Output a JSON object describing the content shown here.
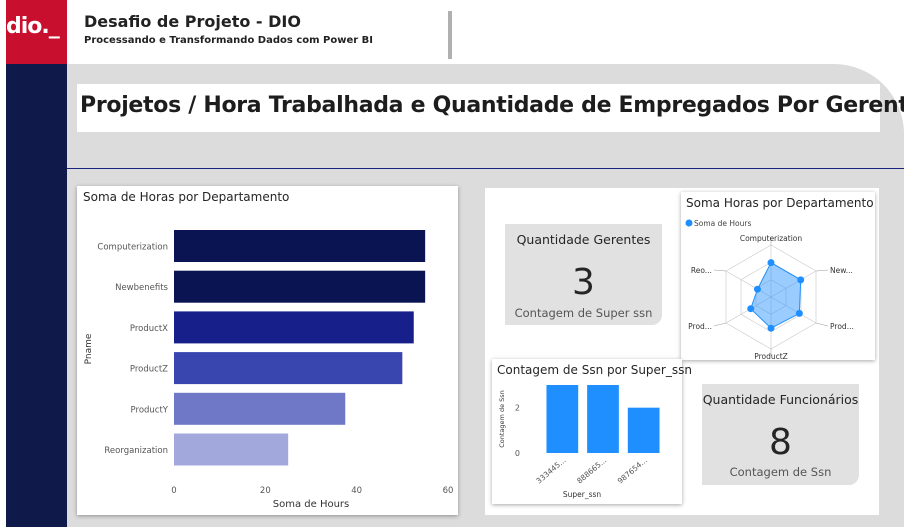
{
  "header": {
    "logo_text": "dio._",
    "title": "Desafio de Projeto - DIO",
    "subtitle": "Processando e Transformando Dados com Power BI"
  },
  "page_title": "Projetos / Hora Trabalhada e Quantidade de Empregados Por Gerentes",
  "kpis": {
    "gerentes": {
      "title": "Quantidade Gerentes",
      "value": "3",
      "subtitle": "Contagem de Super ssn"
    },
    "funcionarios": {
      "title": "Quantidade Funcionários",
      "value": "8",
      "subtitle": "Contagem de Ssn"
    }
  },
  "colors": {
    "sidebar": "#0f1a4a",
    "logo": "#c8102e",
    "bars": [
      "#0b1452",
      "#0b1452",
      "#17208a",
      "#3a46b0",
      "#6f78c6",
      "#a2a8dc"
    ],
    "column": "#1f8fff",
    "radar": "#1f8fff"
  },
  "chart_data": [
    {
      "type": "bar",
      "orientation": "horizontal",
      "title": "Soma de Horas por Departamento",
      "xlabel": "Soma de Hours",
      "ylabel": "Pname",
      "categories": [
        "Computerization",
        "Newbenefits",
        "ProductX",
        "ProductZ",
        "ProductY",
        "Reorganization"
      ],
      "values": [
        55,
        55,
        52.5,
        50,
        37.5,
        25
      ],
      "xlim": [
        0,
        60
      ],
      "xticks": [
        0,
        20,
        40,
        60
      ],
      "grid": false
    },
    {
      "type": "radar",
      "title": "Soma Horas por Departamento",
      "legend": [
        "Soma de Hours"
      ],
      "legend_position": "top-left",
      "categories": [
        "Computerization",
        "New...",
        "Prod...",
        "ProductZ",
        "Prod...",
        "Reo..."
      ],
      "series": [
        {
          "name": "Soma de Hours",
          "values": [
            55,
            55,
            52.5,
            50,
            37.5,
            25
          ]
        }
      ],
      "rlim": [
        0,
        60
      ]
    },
    {
      "type": "bar",
      "orientation": "vertical",
      "title": "Contagem de Ssn por Super_ssn",
      "xlabel": "Super_ssn",
      "ylabel": "Contagem de Ssn",
      "categories": [
        "333445...",
        "888665...",
        "987654..."
      ],
      "values": [
        3,
        3,
        2
      ],
      "ylim": [
        0,
        3
      ],
      "yticks": [
        0,
        2
      ],
      "grid": false
    }
  ]
}
